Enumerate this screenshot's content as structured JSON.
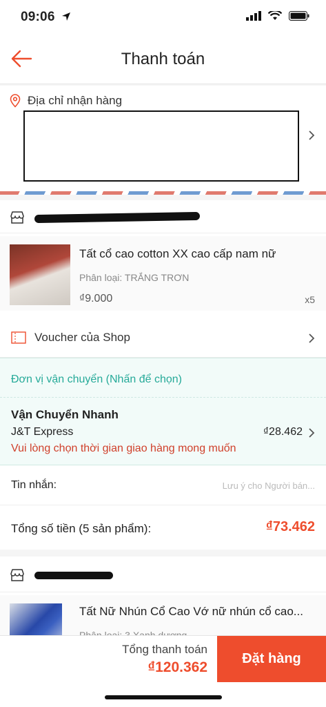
{
  "status_bar": {
    "time": "09:06"
  },
  "header": {
    "title": "Thanh toán"
  },
  "address": {
    "label": "Địa chỉ nhận hàng"
  },
  "shop1": {
    "product": {
      "title": "Tất cổ cao cotton XX cao cấp nam nữ",
      "variant": "Phân loại: TRẮNG TRƠN",
      "price": "₫9.000",
      "quantity": "x5"
    },
    "voucher_label": "Voucher của Shop",
    "shipping": {
      "title": "Đơn vị vận chuyển (Nhấn để chọn)",
      "type": "Vận Chuyển Nhanh",
      "carrier": "J&T Express",
      "price": "₫28.462",
      "warning": "Vui lòng chọn thời gian giao hàng mong muốn"
    },
    "message": {
      "label": "Tin nhắn:",
      "placeholder": "Lưu ý cho Người bán..."
    },
    "total": {
      "label": "Tổng số tiền (5 sản phẩm):",
      "value": "₫73.462"
    }
  },
  "shop2": {
    "product": {
      "title": "Tất Nữ Nhún Cổ Cao Vớ nữ nhún cổ cao...",
      "variant": "Phân loại: 3 Xanh dương"
    }
  },
  "bottom_bar": {
    "grand_label": "Tổng thanh toán",
    "grand_value": "₫120.362",
    "order_button": "Đặt hàng"
  },
  "colors": {
    "accent": "#ee4d2d",
    "shipping_green": "#26aa99"
  }
}
